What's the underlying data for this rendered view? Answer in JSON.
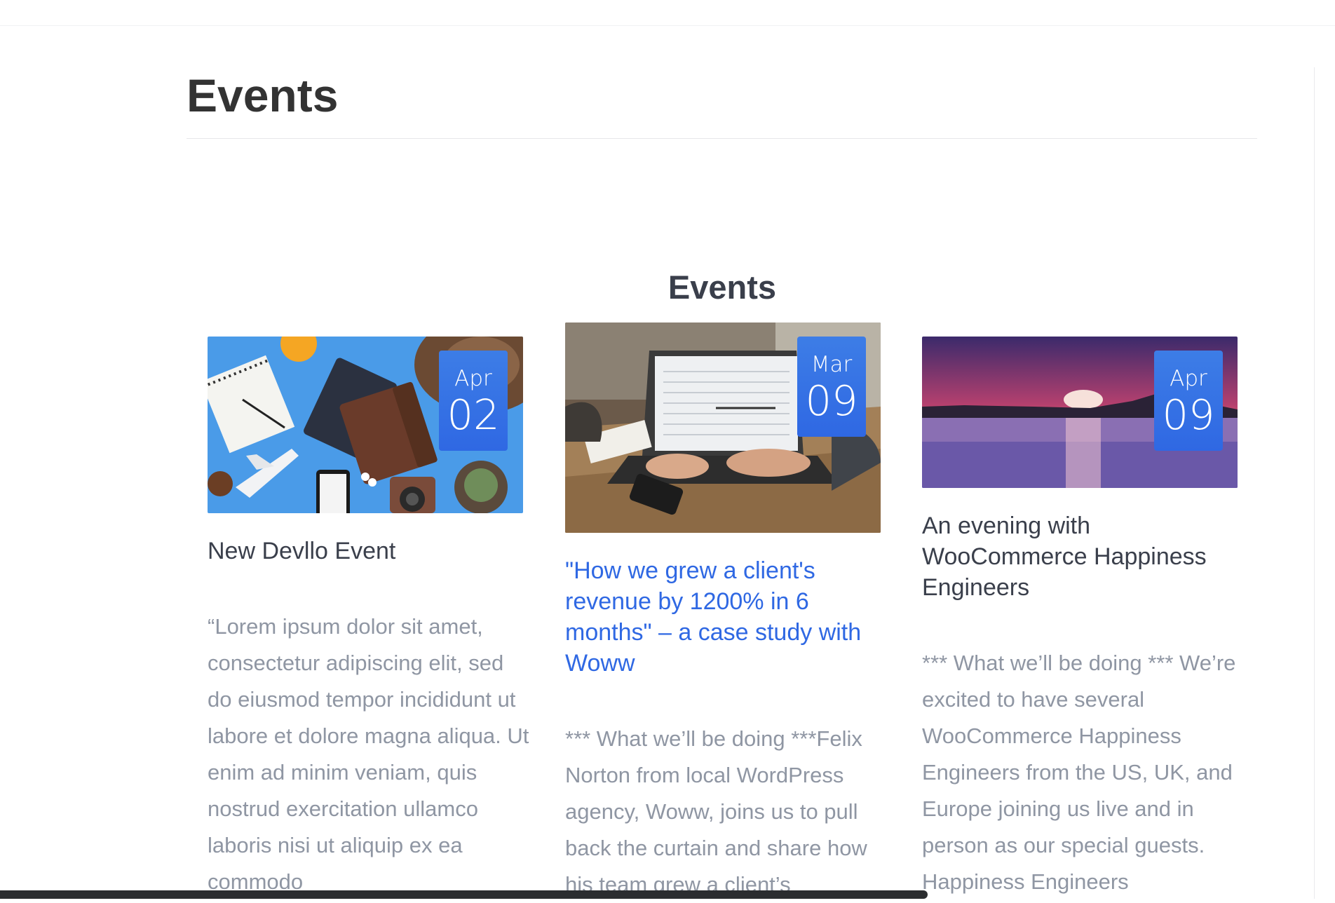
{
  "page": {
    "title": "Events"
  },
  "section": {
    "title": "Events"
  },
  "events": [
    {
      "month": "Apr",
      "day": "02",
      "title": "New Devllo Event",
      "excerpt": "“Lorem ipsum dolor sit amet, consectetur adipiscing elit, sed do eiusmod tempor incididunt ut labore et dolore magna aliqua. Ut enim ad minim veniam, quis nostrud exercitation ullamco laboris nisi ut aliquip ex ea commodo",
      "image": "travel-flatlay-photo"
    },
    {
      "month": "Mar",
      "day": "09",
      "title": "\"How we grew a client's revenue by 1200% in 6 months\" – a case study with Woww",
      "excerpt": "*** What we’ll be doing ***Felix Norton from local WordPress agency, Woww, joins us to pull back the curtain and share how his team grew a client’s",
      "image": "laptop-meeting-photo"
    },
    {
      "month": "Apr",
      "day": "09",
      "title": "An evening with WooCommerce Happiness Engineers",
      "excerpt": "*** What we’ll be doing *** We’re excited to have several WooCommerce Happiness Engineers from the US, UK, and Europe joining us live and in person as our special guests. Happiness Engineers",
      "image": "sunset-sea-photo"
    }
  ],
  "colors": {
    "accent": "#2f68e3",
    "title_text": "#3a3f4b",
    "body_text": "#8f96a3"
  }
}
